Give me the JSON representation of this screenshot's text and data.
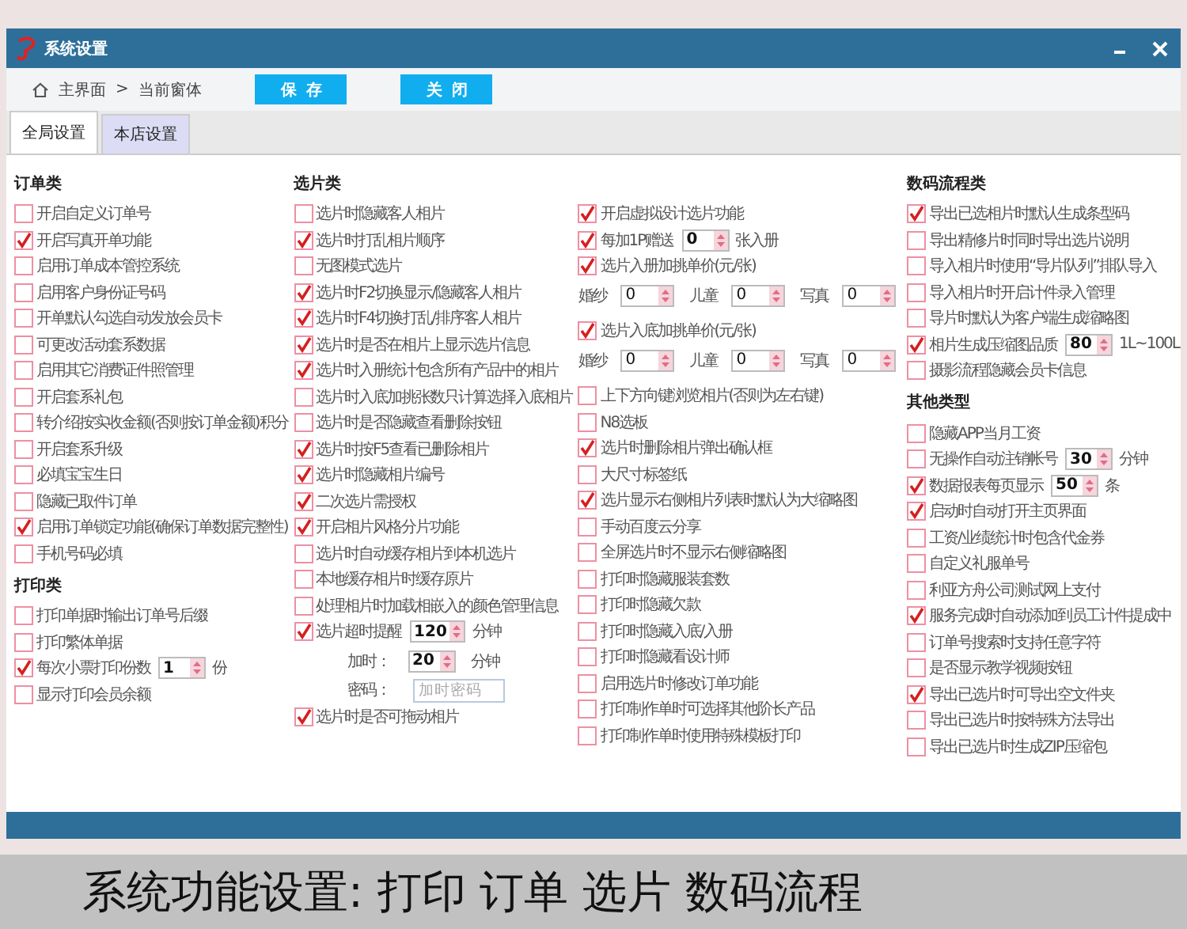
{
  "window": {
    "title": "系统设置"
  },
  "breadcrumb": {
    "home": "主界面",
    "separator": ">",
    "current": "当前窗体"
  },
  "buttons": [
    "保存",
    "关闭"
  ],
  "tabs": [
    {
      "label": "全局设置",
      "selected": true
    },
    {
      "label": "本店设置",
      "selected": false
    }
  ],
  "columns": [
    [
      {
        "kind": "heading",
        "text": "订单类"
      },
      {
        "kind": "check",
        "label": "开启自定义订单号",
        "checked": false
      },
      {
        "kind": "check",
        "label": "开启写真开单功能",
        "checked": true
      },
      {
        "kind": "check",
        "label": "启用订单成本管控系统",
        "checked": false
      },
      {
        "kind": "check",
        "label": "启用客户身份证号码",
        "checked": false
      },
      {
        "kind": "check",
        "label": "开单默认勾选自动发放会员卡",
        "checked": false
      },
      {
        "kind": "check",
        "label": "可更改活动套系数据",
        "checked": false
      },
      {
        "kind": "check",
        "label": "启用其它消费证件照管理",
        "checked": false
      },
      {
        "kind": "check",
        "label": "开启套系礼包",
        "checked": false
      },
      {
        "kind": "check",
        "label": "转介绍按实收金额(否则按订单金额)积分",
        "checked": false
      },
      {
        "kind": "check",
        "label": "开启套系升级",
        "checked": false
      },
      {
        "kind": "check",
        "label": "必填宝宝生日",
        "checked": false
      },
      {
        "kind": "check",
        "label": "隐藏已取件订单",
        "checked": false
      },
      {
        "kind": "check",
        "label": "启用订单锁定功能(确保订单数据完整性)",
        "checked": true
      },
      {
        "kind": "check",
        "label": "手机号码必填",
        "checked": false
      },
      {
        "kind": "heading",
        "text": "打印类"
      },
      {
        "kind": "check",
        "label": "打印单据时输出订单号后缀",
        "checked": false
      },
      {
        "kind": "check",
        "label": "打印繁体单据",
        "checked": false
      },
      {
        "kind": "check-spin",
        "label": "每次小票打印份数",
        "checked": true,
        "value": "1",
        "unit": "份"
      },
      {
        "kind": "check",
        "label": "显示打印会员余额",
        "checked": false
      }
    ],
    [
      {
        "kind": "heading",
        "text": "选片类"
      },
      {
        "kind": "check",
        "label": "选片时隐藏客人相片",
        "checked": false
      },
      {
        "kind": "check",
        "label": "选片时打乱相片顺序",
        "checked": true
      },
      {
        "kind": "check",
        "label": "无图模式选片",
        "checked": false
      },
      {
        "kind": "check",
        "label": "选片时F2切换显示/隐藏客人相片",
        "checked": true
      },
      {
        "kind": "check",
        "label": "选片时F4切换打乱/排序客人相片",
        "checked": true
      },
      {
        "kind": "check",
        "label": "选片时是否在相片上显示选片信息",
        "checked": true
      },
      {
        "kind": "check",
        "label": "选片时入册统计包含所有产品中的相片",
        "checked": true
      },
      {
        "kind": "check",
        "label": "选片时入底加挑张数只计算选择入底相片",
        "checked": false
      },
      {
        "kind": "check",
        "label": "选片时是否隐藏查看删除按钮",
        "checked": false
      },
      {
        "kind": "check",
        "label": "选片时按F5查看已删除相片",
        "checked": true
      },
      {
        "kind": "check",
        "label": "选片时隐藏相片编号",
        "checked": true
      },
      {
        "kind": "check",
        "label": "二次选片需授权",
        "checked": true
      },
      {
        "kind": "check",
        "label": "开启相片风格分片功能",
        "checked": true
      },
      {
        "kind": "check",
        "label": "选片时自动缓存相片到本机选片",
        "checked": false
      },
      {
        "kind": "check",
        "label": "本地缓存相片时缓存原片",
        "checked": false
      },
      {
        "kind": "check",
        "label": "处理相片时加载相嵌入的颜色管理信息",
        "checked": false
      },
      {
        "kind": "check-spin",
        "label": "选片超时提醒",
        "checked": true,
        "value": "120",
        "unit": "分钟"
      },
      {
        "kind": "spin",
        "label": "加时：",
        "value": "20",
        "unit": "分钟"
      },
      {
        "kind": "input",
        "label": "密码：",
        "placeholder": "加时密码"
      },
      {
        "kind": "check",
        "label": "选片时是否可拖动相片",
        "checked": true
      }
    ],
    [
      {
        "kind": "check",
        "label": "开启虚拟设计选片功能",
        "checked": true
      },
      {
        "kind": "check-spin",
        "label": "每加1P赠送",
        "checked": true,
        "value": "0",
        "unit": "张入册"
      },
      {
        "kind": "check",
        "label": "选片入册加挑单价(元/张)",
        "checked": true
      },
      {
        "kind": "spin-group",
        "fields": [
          {
            "label": "婚纱",
            "value": "0"
          },
          {
            "label": "儿童",
            "value": "0"
          },
          {
            "label": "写真",
            "value": "0"
          }
        ]
      },
      {
        "kind": "check",
        "label": "选片入底加挑单价(元/张)",
        "checked": true
      },
      {
        "kind": "spin-group",
        "fields": [
          {
            "label": "婚纱",
            "value": "0"
          },
          {
            "label": "儿童",
            "value": "0"
          },
          {
            "label": "写真",
            "value": "0"
          }
        ]
      },
      {
        "kind": "check",
        "label": "上下方向键浏览相片(否则为左右键)",
        "checked": false
      },
      {
        "kind": "check",
        "label": "N8选板",
        "checked": false
      },
      {
        "kind": "check",
        "label": "选片时删除相片弹出确认框",
        "checked": true
      },
      {
        "kind": "check",
        "label": "大尺寸标签纸",
        "checked": false
      },
      {
        "kind": "check",
        "label": "选片显示右侧相片列表时默认为大缩略图",
        "checked": true
      },
      {
        "kind": "check",
        "label": "手动百度云分享",
        "checked": false
      },
      {
        "kind": "check",
        "label": "全屏选片时不显示右侧缩略图",
        "checked": false
      },
      {
        "kind": "check",
        "label": "打印时隐藏服装套数",
        "checked": false
      },
      {
        "kind": "check",
        "label": "打印时隐藏欠款",
        "checked": false
      },
      {
        "kind": "check",
        "label": "打印时隐藏入底/入册",
        "checked": false
      },
      {
        "kind": "check",
        "label": "打印时隐藏看设计师",
        "checked": false
      },
      {
        "kind": "check",
        "label": "启用选片时修改订单功能",
        "checked": false
      },
      {
        "kind": "check",
        "label": "打印制作单时可选择其他阶长产品",
        "checked": false
      },
      {
        "kind": "check",
        "label": "打印制作单时使用特殊模板打印",
        "checked": false
      }
    ],
    [
      {
        "kind": "heading",
        "text": "数码流程类"
      },
      {
        "kind": "check",
        "label": "导出已选相片时默认生成条型码",
        "checked": true
      },
      {
        "kind": "check",
        "label": "导出精修片时同时导出选片说明",
        "checked": false
      },
      {
        "kind": "check",
        "label": "导入相片时使用“导片队列”排队导入",
        "checked": false
      },
      {
        "kind": "check",
        "label": "导入相片时开启计件录入管理",
        "checked": false
      },
      {
        "kind": "check",
        "label": "导片时默认为客户端生成缩略图",
        "checked": false
      },
      {
        "kind": "check-spin",
        "label": "相片生成压缩图品质",
        "checked": true,
        "value": "80",
        "unit": "1L~100L"
      },
      {
        "kind": "check",
        "label": "摄影流程隐藏会员卡信息",
        "checked": false
      },
      {
        "kind": "heading",
        "text": "其他类型"
      },
      {
        "kind": "check",
        "label": "隐藏APP当月工资",
        "checked": false
      },
      {
        "kind": "check-spin",
        "label": "无操作自动注销帐号",
        "checked": false,
        "value": "30",
        "unit": "分钟"
      },
      {
        "kind": "check-spin",
        "label": "数据报表每页显示",
        "checked": true,
        "value": "50",
        "unit": "条"
      },
      {
        "kind": "check",
        "label": "启动时自动打开主页界面",
        "checked": true
      },
      {
        "kind": "check",
        "label": "工资/业绩统计时包含代金券",
        "checked": false
      },
      {
        "kind": "check",
        "label": "自定义礼服单号",
        "checked": false
      },
      {
        "kind": "check",
        "label": "利亚方舟公司测试网上支付",
        "checked": false
      },
      {
        "kind": "check",
        "label": "服务完成时自动添加到员工计件提成中",
        "checked": true
      },
      {
        "kind": "check",
        "label": "订单号搜索时支持任意字符",
        "checked": false
      },
      {
        "kind": "check",
        "label": "是否显示教学视频按钮",
        "checked": false
      },
      {
        "kind": "check",
        "label": "导出已选片时可导出空文件夹",
        "checked": true
      },
      {
        "kind": "check",
        "label": "导出已选片时按特殊方法导出",
        "checked": false
      },
      {
        "kind": "check",
        "label": "导出已选片时生成ZIP压缩包",
        "checked": false
      }
    ]
  ],
  "caption": "系统功能设置: 打印 订单 选片 数码流程"
}
